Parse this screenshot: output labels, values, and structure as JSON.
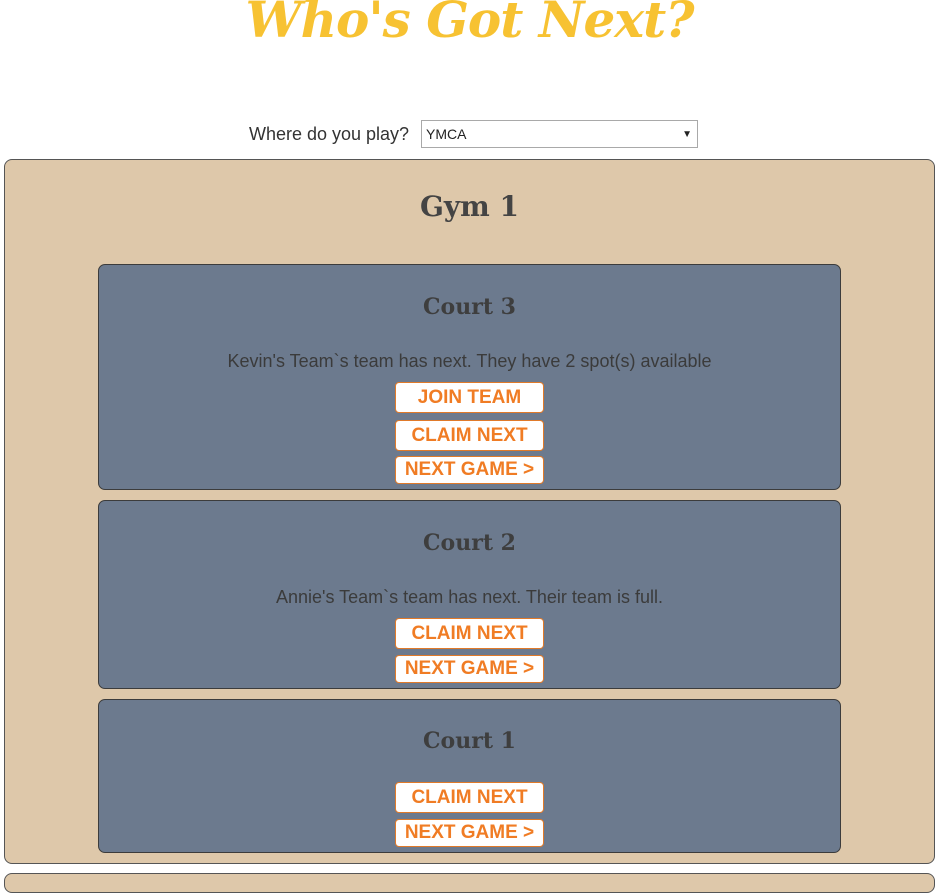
{
  "app": {
    "title": "Who's Got Next?"
  },
  "location": {
    "label": "Where do you play?",
    "selected": "YMCA"
  },
  "gym": {
    "name": "Gym 1",
    "courts": [
      {
        "name": "Court 3",
        "status": "Kevin's Team`s team has next. They have 2 spot(s) available",
        "join_label": "JOIN TEAM",
        "claim_label": "CLAIM NEXT",
        "next_label": "NEXT GAME >"
      },
      {
        "name": "Court 2",
        "status": "Annie's Team`s team has next. Their team is full.",
        "claim_label": "CLAIM NEXT",
        "next_label": "NEXT GAME >"
      },
      {
        "name": "Court 1",
        "status": "",
        "claim_label": "CLAIM NEXT",
        "next_label": "NEXT GAME >"
      }
    ]
  },
  "colors": {
    "title": "#f7c232",
    "gym_panel": "#dec8aa",
    "court_card": "#6c7a8e",
    "button_text": "#f07c24"
  }
}
